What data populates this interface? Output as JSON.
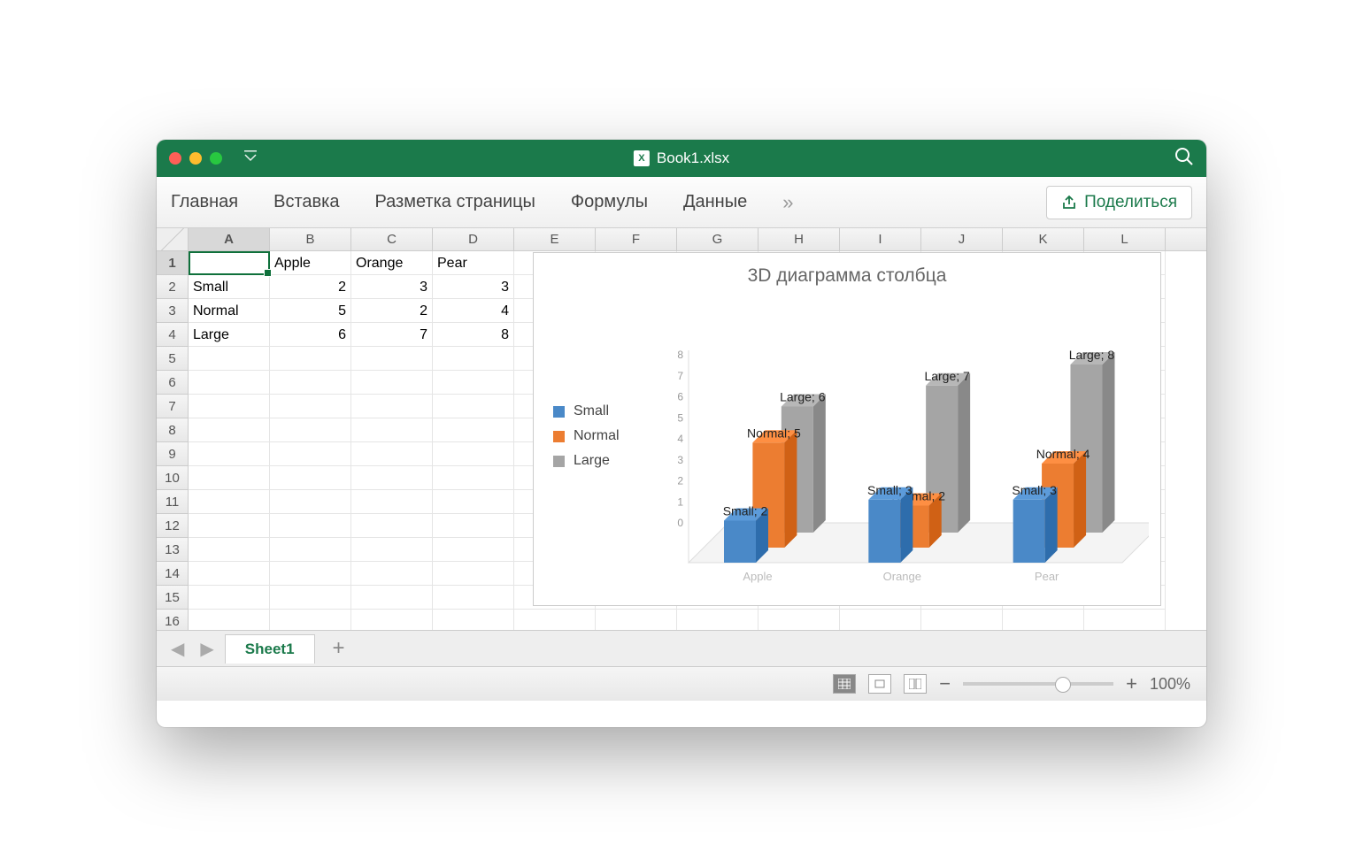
{
  "window": {
    "title": "Book1.xlsx"
  },
  "ribbon": {
    "tabs": [
      "Главная",
      "Вставка",
      "Разметка страницы",
      "Формулы",
      "Данные"
    ],
    "share": "Поделиться"
  },
  "columns": [
    "A",
    "B",
    "C",
    "D",
    "E",
    "F",
    "G",
    "H",
    "I",
    "J",
    "K",
    "L"
  ],
  "active_cell": "A1",
  "cells": {
    "B1": "Apple",
    "C1": "Orange",
    "D1": "Pear",
    "A2": "Small",
    "B2": "2",
    "C2": "3",
    "D2": "3",
    "A3": "Normal",
    "B3": "5",
    "C3": "2",
    "D3": "4",
    "A4": "Large",
    "B4": "6",
    "C4": "7",
    "D4": "8"
  },
  "row_count": 16,
  "sheets": {
    "active": "Sheet1"
  },
  "status": {
    "zoom": "100%"
  },
  "chart": {
    "title": "3D диаграмма столбца",
    "legend": [
      "Small",
      "Normal",
      "Large"
    ],
    "colors": {
      "Small": "#4a89c8",
      "Normal": "#ec7d31",
      "Large": "#a5a5a5"
    },
    "categories": [
      "Apple",
      "Orange",
      "Pear"
    ],
    "yticks": [
      0,
      1,
      2,
      3,
      4,
      5,
      6,
      7,
      8
    ]
  },
  "chart_data": {
    "type": "bar",
    "title": "3D диаграмма столбца",
    "categories": [
      "Apple",
      "Orange",
      "Pear"
    ],
    "series": [
      {
        "name": "Small",
        "values": [
          2,
          3,
          3
        ]
      },
      {
        "name": "Normal",
        "values": [
          5,
          2,
          4
        ]
      },
      {
        "name": "Large",
        "values": [
          6,
          7,
          8
        ]
      }
    ],
    "xlabel": "",
    "ylabel": "",
    "ylim": [
      0,
      8
    ],
    "data_labels": true,
    "legend_position": "left",
    "style": "3d-clustered-column"
  }
}
